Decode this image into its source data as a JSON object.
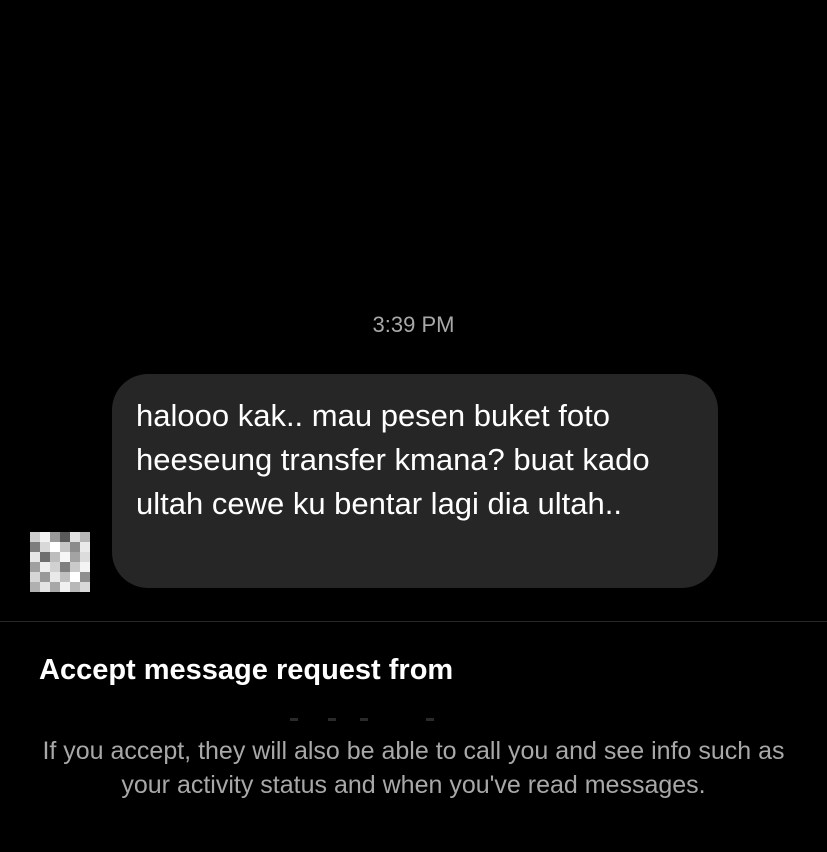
{
  "thread": {
    "timestamp": "3:39 PM",
    "message": {
      "text": "halooo kak.. mau pesen buket foto heeseung transfer kmana? buat kado ultah cewe ku bentar lagi dia ultah.."
    }
  },
  "request": {
    "title": "Accept message request from",
    "description": "If you accept, they will also be able to call you and see info such as your activity status and when you've read messages."
  },
  "colors": {
    "background": "#000000",
    "bubble": "#262626",
    "secondary_text": "#a8a8a8"
  }
}
